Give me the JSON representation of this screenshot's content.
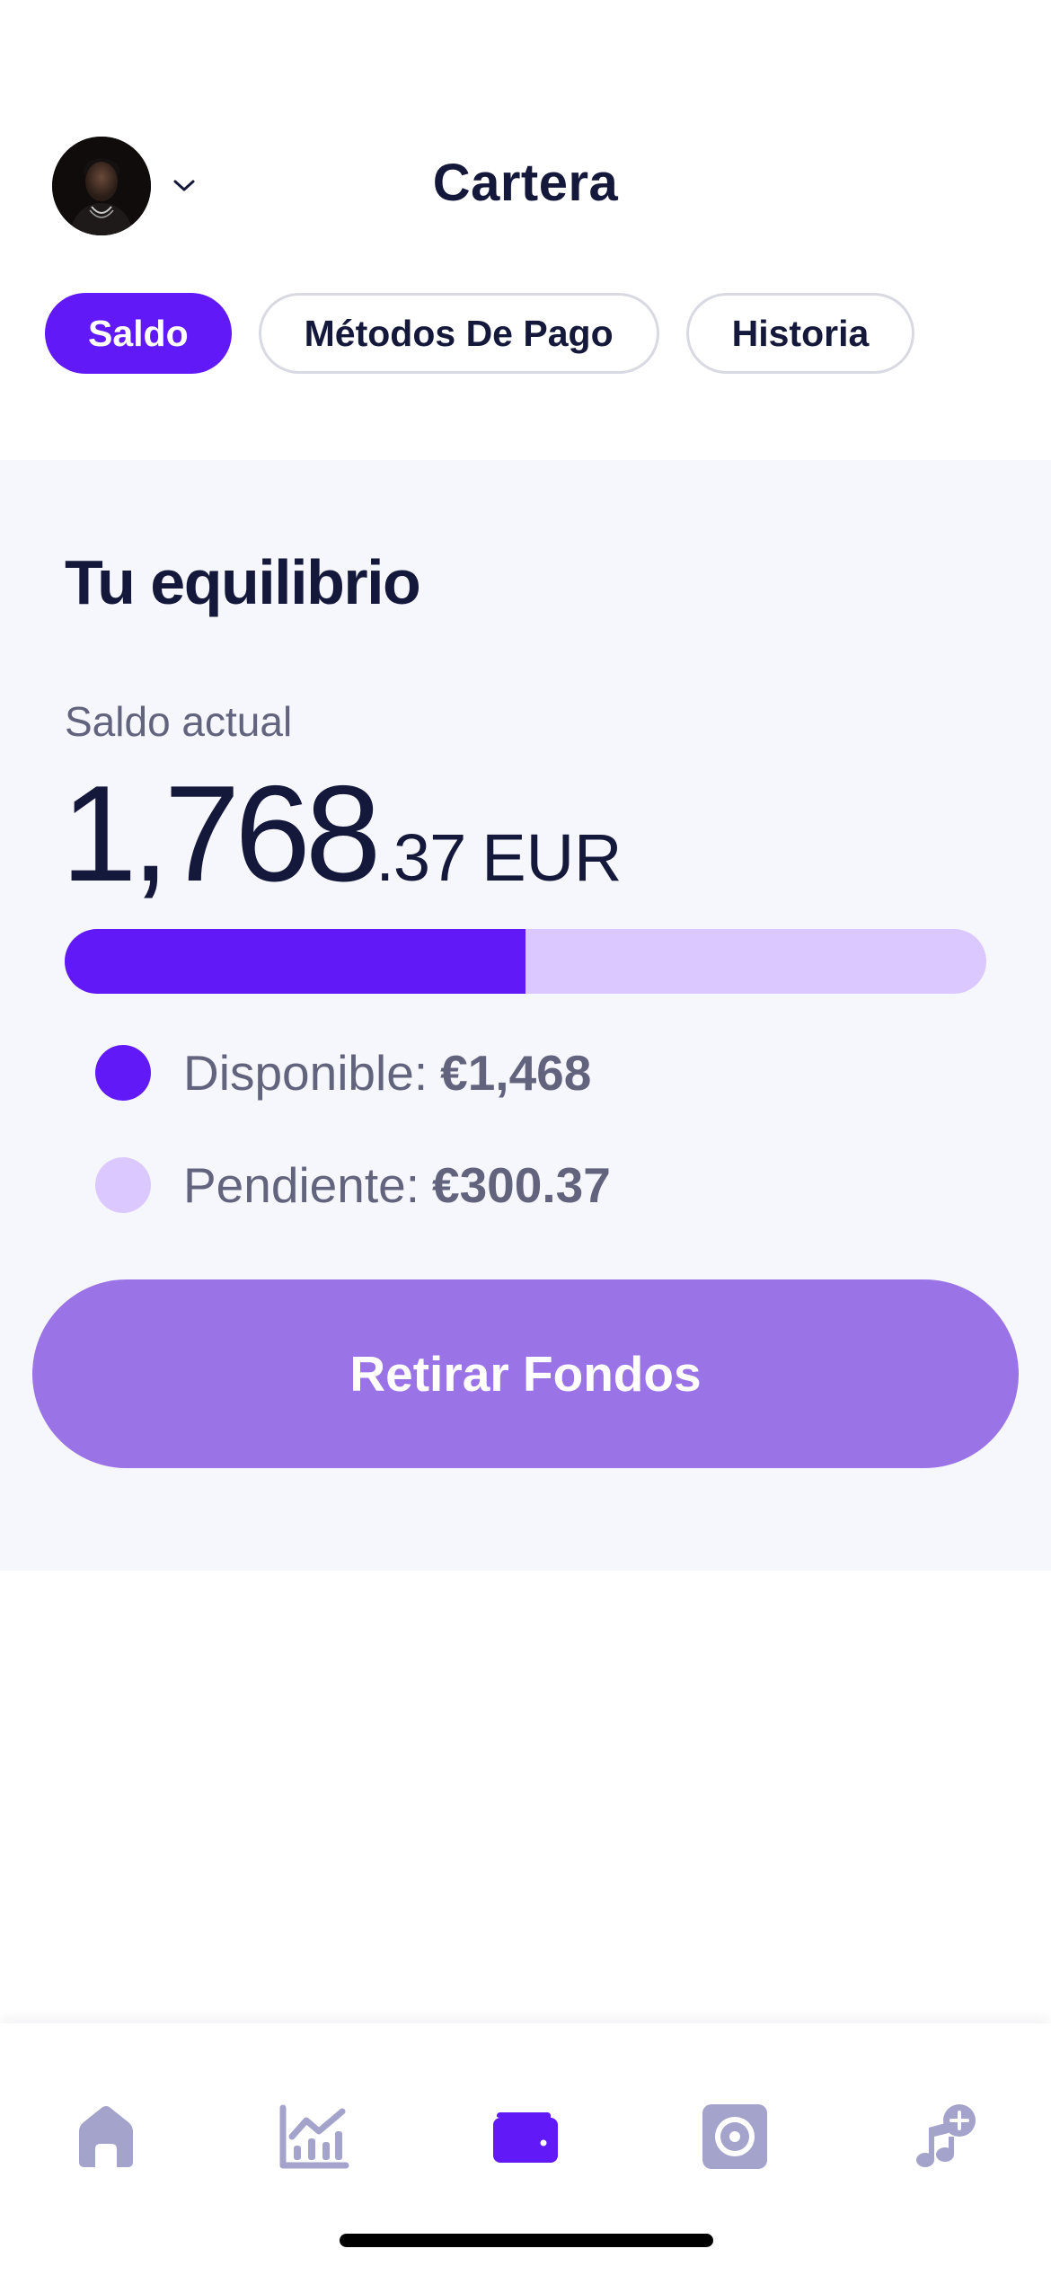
{
  "header": {
    "title": "Cartera",
    "avatar_icon": "user-avatar",
    "dropdown_icon": "chevron-down-icon"
  },
  "tabs": [
    {
      "label": "Saldo",
      "active": true
    },
    {
      "label": "Métodos De Pago",
      "active": false
    },
    {
      "label": "Historia",
      "active": false
    }
  ],
  "balance": {
    "title": "Tu equilibrio",
    "label": "Saldo actual",
    "amount_main": "1,768",
    "amount_decimal": ".37",
    "currency": "EUR",
    "available_fraction": 0.5,
    "available_label": "Disponible:",
    "available_value": "€1,468",
    "pending_label": "Pendiente:",
    "pending_value": "€300.37",
    "withdraw_label": "Retirar Fondos"
  },
  "bottom_nav": [
    {
      "icon": "home-icon",
      "active": false
    },
    {
      "icon": "analytics-chart-icon",
      "active": false
    },
    {
      "icon": "wallet-icon",
      "active": true
    },
    {
      "icon": "record-disc-icon",
      "active": false
    },
    {
      "icon": "add-music-icon",
      "active": false
    }
  ],
  "colors": {
    "accent": "#6119f7",
    "accent_light": "#dbc8ff",
    "button_muted": "#9a74e7",
    "nav_inactive": "#a4a3cc",
    "text_dark": "#14183a",
    "text_muted": "#62647e",
    "panel_bg": "#f6f6fd"
  }
}
